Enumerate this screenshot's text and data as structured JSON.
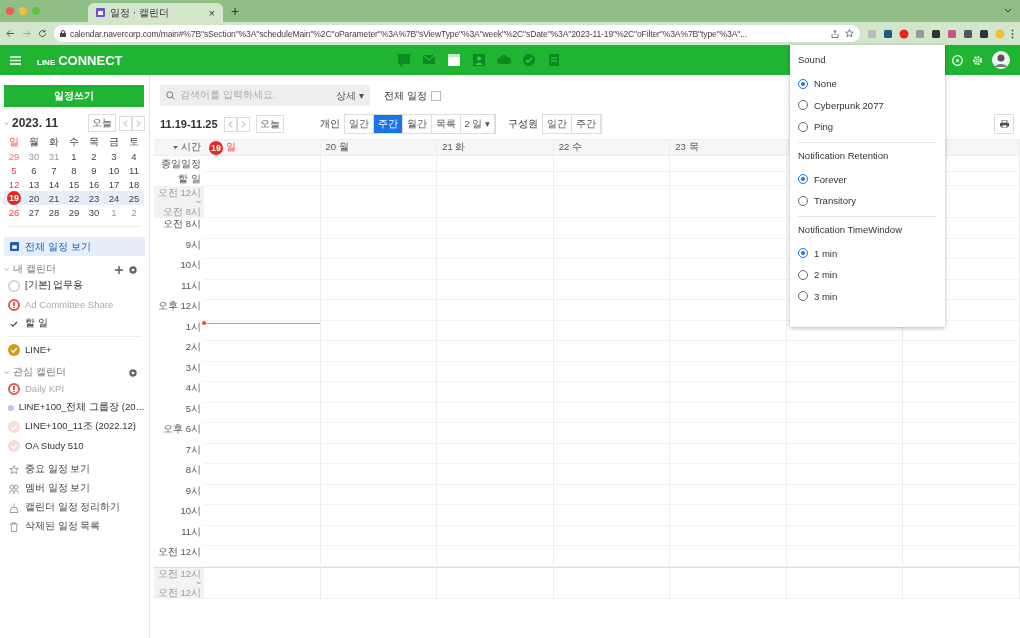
{
  "browser": {
    "tab": {
      "title": "일정 · 캘린더",
      "selected": true
    },
    "tab_close": "×",
    "new_tab": "+",
    "url": "calendar.navercorp.com/main#%7B\"sSection\"%3A\"scheduleMain\"%2C\"oParameter\"%3A%7B\"sViewType\"%3A\"week\"%2C\"sDate\"%3A\"2023-11-19\"%2C\"oFilter\"%3A%7B\"type\"%3A\"..."
  },
  "app_header": {
    "logo_small": "LINE",
    "logo": "CONNECT"
  },
  "sidebar": {
    "create_button": "일정쓰기",
    "mini_calendar": {
      "title": "2023. 11",
      "today_button": "오늘",
      "weekdays": [
        "일",
        "월",
        "화",
        "수",
        "목",
        "금",
        "토"
      ],
      "weeks": [
        {
          "selected": false,
          "days": [
            {
              "day": "29",
              "other_month": true,
              "today": false
            },
            {
              "day": "30",
              "other_month": true,
              "today": false
            },
            {
              "day": "31",
              "other_month": true,
              "today": false
            },
            {
              "day": "1",
              "other_month": false,
              "today": false
            },
            {
              "day": "2",
              "other_month": false,
              "today": false
            },
            {
              "day": "3",
              "other_month": false,
              "today": false
            },
            {
              "day": "4",
              "other_month": false,
              "today": false
            }
          ]
        },
        {
          "selected": false,
          "days": [
            {
              "day": "5",
              "other_month": false,
              "today": false
            },
            {
              "day": "6",
              "other_month": false,
              "today": false
            },
            {
              "day": "7",
              "other_month": false,
              "today": false
            },
            {
              "day": "8",
              "other_month": false,
              "today": false
            },
            {
              "day": "9",
              "other_month": false,
              "today": false
            },
            {
              "day": "10",
              "other_month": false,
              "today": false
            },
            {
              "day": "11",
              "other_month": false,
              "today": false
            }
          ]
        },
        {
          "selected": false,
          "days": [
            {
              "day": "12",
              "other_month": false,
              "today": false
            },
            {
              "day": "13",
              "other_month": false,
              "today": false
            },
            {
              "day": "14",
              "other_month": false,
              "today": false
            },
            {
              "day": "15",
              "other_month": false,
              "today": false
            },
            {
              "day": "16",
              "other_month": false,
              "today": false
            },
            {
              "day": "17",
              "other_month": false,
              "today": false
            },
            {
              "day": "18",
              "other_month": false,
              "today": false
            }
          ]
        },
        {
          "selected": true,
          "days": [
            {
              "day": "19",
              "other_month": false,
              "today": true
            },
            {
              "day": "20",
              "other_month": false,
              "today": false
            },
            {
              "day": "21",
              "other_month": false,
              "today": false
            },
            {
              "day": "22",
              "other_month": false,
              "today": false
            },
            {
              "day": "23",
              "other_month": false,
              "today": false
            },
            {
              "day": "24",
              "other_month": false,
              "today": false
            },
            {
              "day": "25",
              "other_month": false,
              "today": false
            }
          ]
        },
        {
          "selected": false,
          "days": [
            {
              "day": "26",
              "other_month": false,
              "today": false
            },
            {
              "day": "27",
              "other_month": false,
              "today": false
            },
            {
              "day": "28",
              "other_month": false,
              "today": false
            },
            {
              "day": "29",
              "other_month": false,
              "today": false
            },
            {
              "day": "30",
              "other_month": false,
              "today": false
            },
            {
              "day": "1",
              "other_month": true,
              "today": false
            },
            {
              "day": "2",
              "other_month": true,
              "today": false
            }
          ]
        }
      ]
    },
    "all_events": {
      "label": "전체 일정 보기",
      "selected": true
    },
    "groups": [
      {
        "title": "내 캘린더",
        "add": true,
        "items": [
          {
            "label": "[기본] 업무용",
            "kind": "empty",
            "color": "#cccccc",
            "disabled": false
          },
          {
            "label": "Ad Committee Share",
            "kind": "alert",
            "color": "#e05a5a",
            "disabled": true
          },
          {
            "label": "할 일",
            "kind": "check",
            "disabled": false
          },
          {
            "label": "LINE+",
            "kind": "filled",
            "color": "#d39b1c",
            "disabled": false
          }
        ]
      },
      {
        "title": "관심 캘린더",
        "add": false,
        "items": [
          {
            "label": "Daily KPI",
            "kind": "alert",
            "color": "#e05a5a",
            "disabled": true
          },
          {
            "label": "LINE+100_전체 그룹장 (20…",
            "kind": "filled",
            "color": "#c9b3ec",
            "disabled": false
          },
          {
            "label": "LINE+100_11조 (2022.12)",
            "kind": "filled",
            "color": "#f6ddd6",
            "disabled": false
          },
          {
            "label": "OA Study 510",
            "kind": "filled",
            "color": "#f6ddd6",
            "disabled": false
          }
        ]
      }
    ],
    "tools": [
      {
        "label": "중요 일정 보기",
        "kind": "star"
      },
      {
        "label": "멤버 일정 보기",
        "kind": "members"
      },
      {
        "label": "캘린더 일정 정리하기",
        "kind": "broom"
      },
      {
        "label": "삭제된 일정 목록",
        "kind": "trash"
      }
    ]
  },
  "toolbar": {
    "search_placeholder": "검색어를 입력하세요.",
    "detail_button": "상세",
    "detail_caret": "▾",
    "filter_label": "전체 일정",
    "filter_checked": false,
    "range": "11.19-11.25",
    "today_button": "오늘",
    "personal_label": "개인",
    "personal_views": [
      {
        "label": "일간",
        "selected": false
      },
      {
        "label": "주간",
        "selected": true
      },
      {
        "label": "월간",
        "selected": false
      },
      {
        "label": "목록",
        "selected": false
      }
    ],
    "days_dropdown": "2 일",
    "days_caret": "▾",
    "member_label": "구성원",
    "member_views": [
      {
        "label": "일간",
        "selected": false
      },
      {
        "label": "주간",
        "selected": false
      }
    ]
  },
  "grid": {
    "time_header": "시간",
    "all_day": "종일일정",
    "todo": "할 일",
    "collapsed_top": [
      "오전 12시",
      "~",
      "오전 8시"
    ],
    "days": [
      {
        "date": "19",
        "weekday": "일",
        "today": true
      },
      {
        "date": "20",
        "weekday": "월",
        "today": false
      },
      {
        "date": "21",
        "weekday": "화",
        "today": false
      },
      {
        "date": "22",
        "weekday": "수",
        "today": false
      },
      {
        "date": "23",
        "weekday": "목",
        "today": false
      }
    ],
    "hours": [
      {
        "label": "오전 8시",
        "now": false
      },
      {
        "label": "9시",
        "now": false
      },
      {
        "label": "10시",
        "now": false
      },
      {
        "label": "11시",
        "now": false
      },
      {
        "label": "오후 12시",
        "now": false
      },
      {
        "label": "1시",
        "now": true
      },
      {
        "label": "2시",
        "now": false
      },
      {
        "label": "3시",
        "now": false
      },
      {
        "label": "4시",
        "now": false
      },
      {
        "label": "5시",
        "now": false
      },
      {
        "label": "오후 6시",
        "now": false
      },
      {
        "label": "7시",
        "now": false
      },
      {
        "label": "8시",
        "now": false
      },
      {
        "label": "9시",
        "now": false
      },
      {
        "label": "10시",
        "now": false
      },
      {
        "label": "11시",
        "now": false
      },
      {
        "label": "오전 12시",
        "now": false
      }
    ],
    "collapsed_bottom": [
      "오전 12시",
      "~",
      "오전 12시"
    ]
  },
  "popup": {
    "sections": [
      {
        "title": "Sound",
        "options": [
          {
            "label": "None",
            "selected": true
          },
          {
            "label": "Cyberpunk 2077",
            "selected": false
          },
          {
            "label": "Ping",
            "selected": false
          }
        ]
      },
      {
        "title": "Notification Retention",
        "options": [
          {
            "label": "Forever",
            "selected": true
          },
          {
            "label": "Transitory",
            "selected": false
          }
        ]
      },
      {
        "title": "Notification TimeWindow",
        "options": [
          {
            "label": "1 min",
            "selected": true
          },
          {
            "label": "2 min",
            "selected": false
          },
          {
            "label": "3 min",
            "selected": false
          }
        ]
      }
    ]
  }
}
